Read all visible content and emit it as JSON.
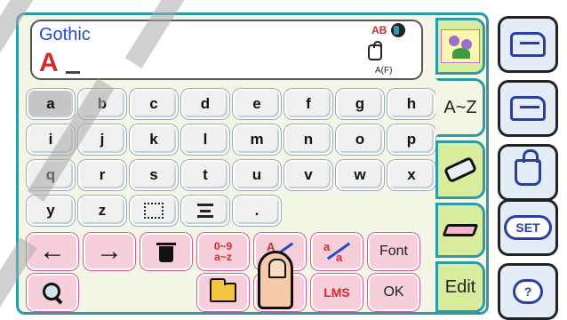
{
  "display": {
    "font_name": "Gothic",
    "typed_text": "A",
    "case_badge": "AB",
    "af_label": "A(F)"
  },
  "keyboard": {
    "rows": [
      [
        "a",
        "b",
        "c",
        "d",
        "e",
        "f",
        "g",
        "h"
      ],
      [
        "i",
        "j",
        "k",
        "l",
        "m",
        "n",
        "o",
        "p"
      ],
      [
        "q",
        "r",
        "s",
        "t",
        "u",
        "v",
        "w",
        "x"
      ],
      [
        "y",
        "z",
        "",
        "",
        "."
      ]
    ]
  },
  "functions": {
    "left_arrow": "←",
    "right_arrow": "→",
    "digits_top": "0~9",
    "digits_bottom": "a~z",
    "case_top": "A",
    "case_bottom": "a",
    "case2_top": "a",
    "case2_bottom": "a",
    "font_label": "Font",
    "lms_label": "LMS",
    "ok_label": "OK"
  },
  "tabs": {
    "alphabet_label": "A~Z",
    "edit_label": "Edit"
  },
  "system": {
    "set_label": "SET",
    "help_label": "?"
  },
  "colors": {
    "accent": "#2c9aa8",
    "function_key": "#f7cfdb",
    "tab": "#d8ec9e",
    "panel": "#f3f6e4",
    "text_red": "#d42a2a",
    "text_blue": "#1f4fbf"
  },
  "icons": {
    "delete": "trash-icon",
    "search": "magnifier-icon",
    "open": "folder-icon",
    "hand": "hand-pointer-icon",
    "pattern": "flower-pattern-icon",
    "eraser": "eraser-icon",
    "machine": "sewing-machine-icon",
    "embroidery": "embroidery-unit-icon",
    "bag": "bag-icon"
  }
}
